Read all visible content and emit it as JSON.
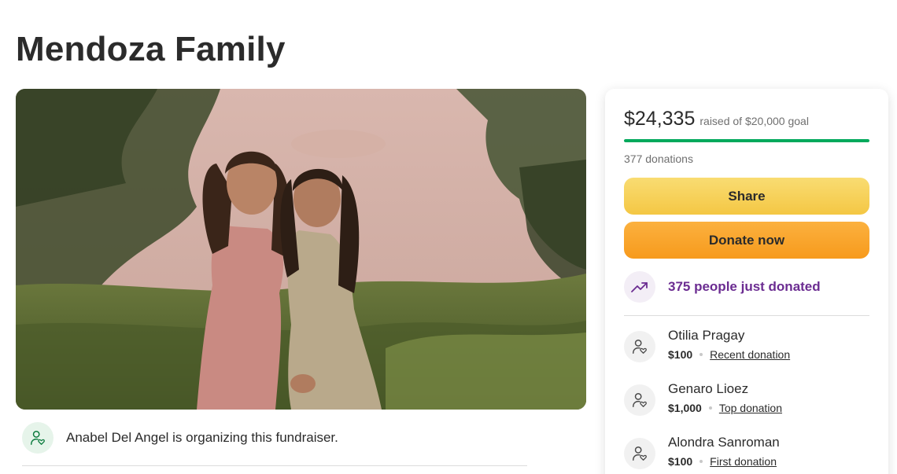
{
  "page": {
    "title": "Mendoza Family"
  },
  "hero": {
    "image": "photo of two girls standing by a pond"
  },
  "organizer": {
    "text": "Anabel Del Angel is organizing this fundraiser.",
    "icon": "person-heart-icon"
  },
  "progress": {
    "raised": "$24,335",
    "goal_text": "raised of $20,000 goal",
    "fraction": 1.0,
    "donations": "377 donations",
    "bar_color": "#02a95c"
  },
  "buttons": {
    "share": "Share",
    "donate": "Donate now"
  },
  "trend": {
    "text": "375 people just donated",
    "icon": "trending-up-icon",
    "color": "#6b2c91"
  },
  "donors": [
    {
      "name": "Otilia Pragay",
      "amount": "$100",
      "tag": "Recent donation"
    },
    {
      "name": "Genaro Lioez",
      "amount": "$1,000",
      "tag": "Top donation"
    },
    {
      "name": "Alondra Sanroman",
      "amount": "$100",
      "tag": "First donation"
    }
  ]
}
